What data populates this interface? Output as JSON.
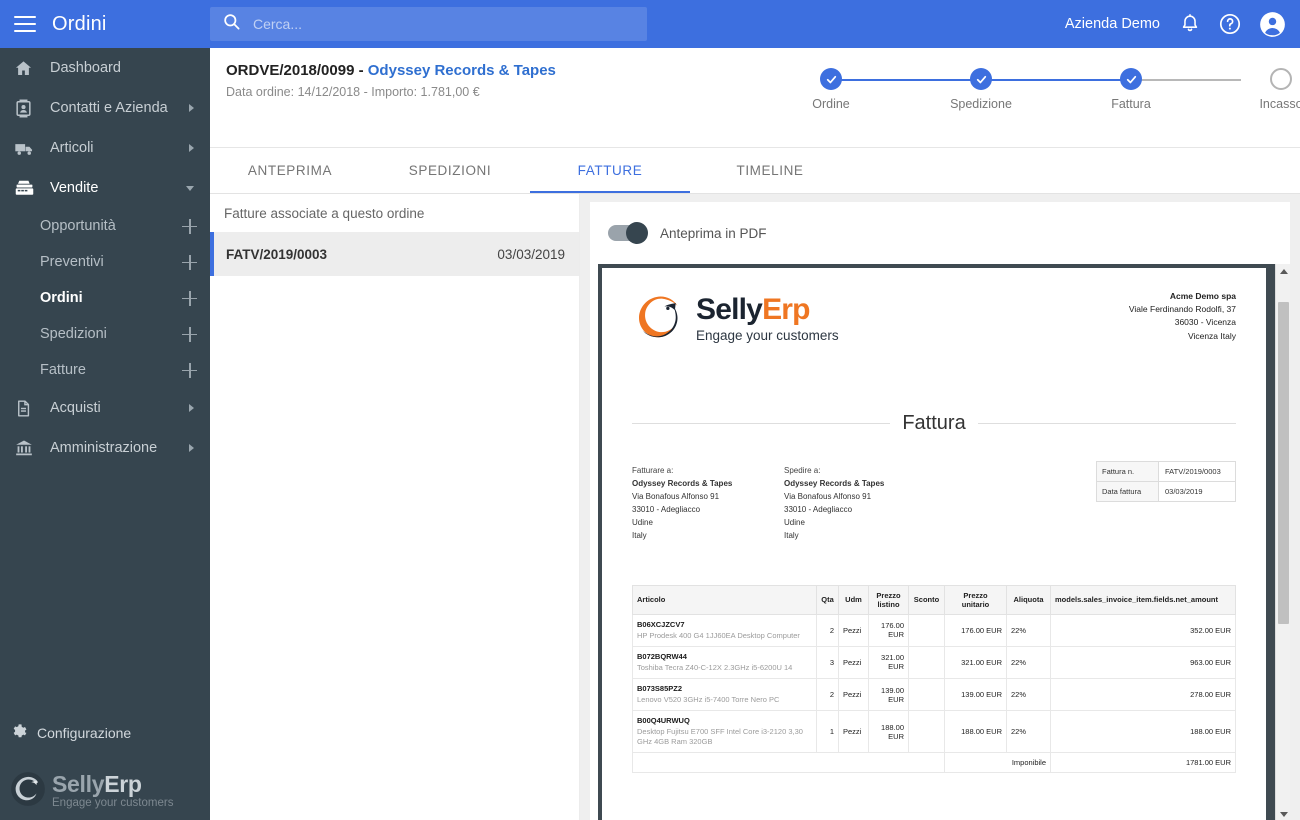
{
  "topbar": {
    "menu_icon": "hamburger-icon",
    "title": "Ordini",
    "search_placeholder": "Cerca...",
    "search_value": "",
    "search_icon": "search-icon",
    "company": "Azienda Demo",
    "notifications_icon": "bell-icon",
    "help_icon": "help-circle-icon",
    "account_icon": "account-circle-icon",
    "accent_color": "#3d6fdf"
  },
  "sidebar": {
    "bg_color": "#36454f",
    "items": [
      {
        "label": "Dashboard",
        "icon": "home-icon",
        "expandable": false,
        "active": false
      },
      {
        "label": "Contatti e Azienda",
        "icon": "contact-card-icon",
        "expandable": true,
        "active": false
      },
      {
        "label": "Articoli",
        "icon": "truck-icon",
        "expandable": true,
        "active": false
      },
      {
        "label": "Vendite",
        "icon": "cash-register-icon",
        "expandable": true,
        "expanded": true,
        "active": true
      }
    ],
    "subitems": [
      {
        "label": "Opportunità",
        "add_icon": "plus-icon",
        "active": false
      },
      {
        "label": "Preventivi",
        "add_icon": "plus-icon",
        "active": false
      },
      {
        "label": "Ordini",
        "add_icon": "plus-icon",
        "active": true
      },
      {
        "label": "Spedizioni",
        "add_icon": "plus-icon",
        "active": false
      },
      {
        "label": "Fatture",
        "add_icon": "plus-icon",
        "active": false
      }
    ],
    "items_after": [
      {
        "label": "Acquisti",
        "icon": "document-icon",
        "expandable": true,
        "active": false
      },
      {
        "label": "Amministrazione",
        "icon": "bank-icon",
        "expandable": true,
        "active": false
      }
    ],
    "config": {
      "label": "Configurazione",
      "icon": "gear-icon"
    },
    "brand": {
      "name_light": "Selly",
      "name_bold": "Erp",
      "tagline": "Engage your customers",
      "logo_icon": "sellyerp-phoenix-logo"
    }
  },
  "order": {
    "code": "ORDVE/2018/0099",
    "separator": " - ",
    "customer": "Odyssey Records & Tapes",
    "subtitle": "Data ordine: 14/12/2018 - Importo: 1.781,00 €"
  },
  "stepper": {
    "steps": [
      {
        "label": "Ordine",
        "done": true
      },
      {
        "label": "Spedizione",
        "done": true
      },
      {
        "label": "Fattura",
        "done": true
      },
      {
        "label": "Incasso",
        "done": false
      }
    ],
    "done_color": "#3d6fdf",
    "todo_color": "#b4b4b4"
  },
  "tabs": [
    {
      "label": "ANTEPRIMA",
      "active": false
    },
    {
      "label": "SPEDIZIONI",
      "active": false
    },
    {
      "label": "FATTURE",
      "active": true
    },
    {
      "label": "TIMELINE",
      "active": false
    }
  ],
  "invoice_list": {
    "heading": "Fatture associate a questo ordine",
    "rows": [
      {
        "number": "FATV/2019/0003",
        "date": "03/03/2019",
        "selected": true
      }
    ]
  },
  "pdf_preview": {
    "toggle_label": "Anteprima in PDF",
    "toggle_on": true,
    "scroll_up_icon": "scroll-up-arrow-icon",
    "scroll_down_icon": "scroll-down-arrow-icon"
  },
  "invoice_doc": {
    "logo": {
      "name_dark": "Selly",
      "name_orange": "Erp",
      "tagline": "Engage your customers",
      "icon": "sellyerp-phoenix-logo"
    },
    "issuer": {
      "name": "Acme Demo spa",
      "lines": [
        "Viale Ferdinando Rodolfi, 37",
        "36030 - Vicenza",
        "Vicenza Italy"
      ]
    },
    "title": "Fattura",
    "bill_to": {
      "label": "Fatturare a:",
      "name": "Odyssey Records & Tapes",
      "lines": [
        "Via Bonafous Alfonso 91",
        "33010 - Adegliacco",
        "Udine",
        "Italy"
      ]
    },
    "ship_to": {
      "label": "Spedire a:",
      "name": "Odyssey Records & Tapes",
      "lines": [
        "Via Bonafous Alfonso 91",
        "33010 - Adegliacco",
        "Udine",
        "Italy"
      ]
    },
    "meta": [
      {
        "key": "Fattura n.",
        "value": "FATV/2019/0003"
      },
      {
        "key": "Data fattura",
        "value": "03/03/2019"
      }
    ],
    "table": {
      "columns": [
        "Articolo",
        "Qta",
        "Udm",
        "Prezzo listino",
        "Sconto",
        "Prezzo unitario",
        "Aliquota",
        "models.sales_invoice_item.fields.net_amount"
      ],
      "rows": [
        {
          "sku": "B06XCJZCV7",
          "description": "HP Prodesk 400 G4 1JJ60EA Desktop Computer",
          "qty": "2",
          "uom": "Pezzi",
          "list_price": "176.00 EUR",
          "discount": "",
          "unit_price": "176.00 EUR",
          "vat": "22%",
          "net_amount": "352.00 EUR"
        },
        {
          "sku": "B072BQRW44",
          "description": "Toshiba Tecra Z40-C-12X 2.3GHz i5-6200U 14",
          "qty": "3",
          "uom": "Pezzi",
          "list_price": "321.00 EUR",
          "discount": "",
          "unit_price": "321.00 EUR",
          "vat": "22%",
          "net_amount": "963.00 EUR"
        },
        {
          "sku": "B073S85PZ2",
          "description": "Lenovo V520 3GHz i5-7400 Torre Nero PC",
          "qty": "2",
          "uom": "Pezzi",
          "list_price": "139.00 EUR",
          "discount": "",
          "unit_price": "139.00 EUR",
          "vat": "22%",
          "net_amount": "278.00 EUR"
        },
        {
          "sku": "B00Q4URWUQ",
          "description": "Desktop Fujitsu E700 SFF Intel Core i3-2120 3,30 GHz 4GB Ram 320GB",
          "qty": "1",
          "uom": "Pezzi",
          "list_price": "188.00 EUR",
          "discount": "",
          "unit_price": "188.00 EUR",
          "vat": "22%",
          "net_amount": "188.00 EUR"
        }
      ],
      "totals": [
        {
          "label": "Imponibile",
          "value": "1781.00 EUR"
        }
      ]
    }
  }
}
